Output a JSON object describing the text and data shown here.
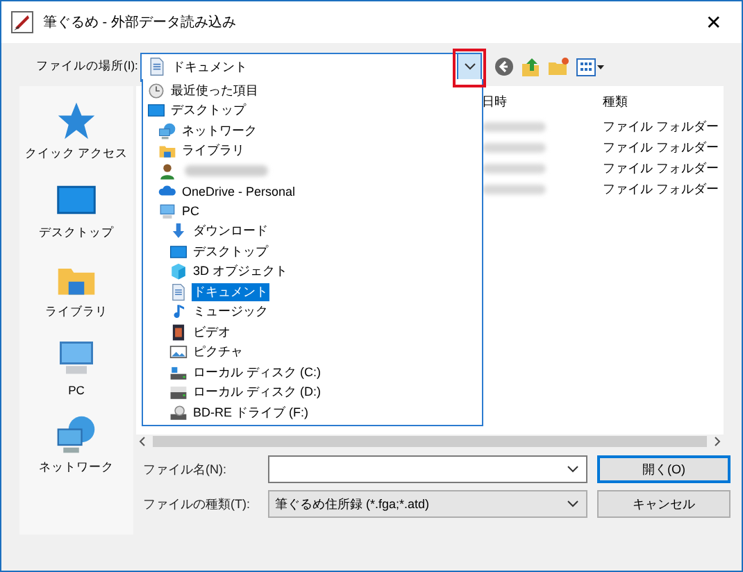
{
  "window": {
    "title": "筆ぐるめ - 外部データ読み込み",
    "close": "✕"
  },
  "location": {
    "label": "ファイルの場所(I):",
    "value": "ドキュメント",
    "expanded": true,
    "highlighted": true
  },
  "sidebar": {
    "items": [
      {
        "label": "クイック アクセス",
        "kind": "star"
      },
      {
        "label": "デスクトップ",
        "kind": "desktop"
      },
      {
        "label": "ライブラリ",
        "kind": "library"
      },
      {
        "label": "PC",
        "kind": "pc"
      },
      {
        "label": "ネットワーク",
        "kind": "network"
      }
    ]
  },
  "table": {
    "columns": [
      "日時",
      "種類"
    ],
    "rows": [
      {
        "type": "ファイル フォルダー"
      },
      {
        "type": "ファイル フォルダー"
      },
      {
        "type": "ファイル フォルダー"
      },
      {
        "type": "ファイル フォルダー"
      }
    ]
  },
  "dropdown": {
    "items": [
      {
        "label": "最近使った項目",
        "kind": "recent",
        "selected": false
      },
      {
        "label": "デスクトップ",
        "kind": "desktop",
        "selected": false,
        "children": [
          {
            "label": "ネットワーク",
            "kind": "network",
            "selected": false
          },
          {
            "label": "ライブラリ",
            "kind": "library",
            "selected": false
          },
          {
            "kind": "user",
            "redacted": true,
            "selected": false
          },
          {
            "label": "OneDrive - Personal",
            "kind": "cloud",
            "selected": false
          },
          {
            "label": "PC",
            "kind": "pc",
            "selected": false,
            "children": [
              {
                "label": "ダウンロード",
                "kind": "download",
                "selected": false
              },
              {
                "label": "デスクトップ",
                "kind": "desktop",
                "selected": false
              },
              {
                "label": "3D オブジェクト",
                "kind": "cube",
                "selected": false
              },
              {
                "label": "ドキュメント",
                "kind": "document",
                "selected": true
              },
              {
                "label": "ミュージック",
                "kind": "music",
                "selected": false
              },
              {
                "label": "ビデオ",
                "kind": "video",
                "selected": false
              },
              {
                "label": "ピクチャ",
                "kind": "pictures",
                "selected": false
              },
              {
                "label": "ローカル ディスク (C:)",
                "kind": "systemdisk",
                "selected": false
              },
              {
                "label": "ローカル ディスク (D:)",
                "kind": "disk",
                "selected": false
              },
              {
                "label": "BD-RE ドライブ (F:)",
                "kind": "optical",
                "selected": false
              }
            ]
          }
        ]
      }
    ]
  },
  "filename": {
    "label": "ファイル名(N):"
  },
  "filetype": {
    "label": "ファイルの種類(T):",
    "value": "筆ぐるめ住所録 (*.fga;*.atd)"
  },
  "buttons": [
    {
      "label": "開く(O)",
      "default": true
    },
    {
      "label": "キャンセル",
      "default": false
    }
  ]
}
